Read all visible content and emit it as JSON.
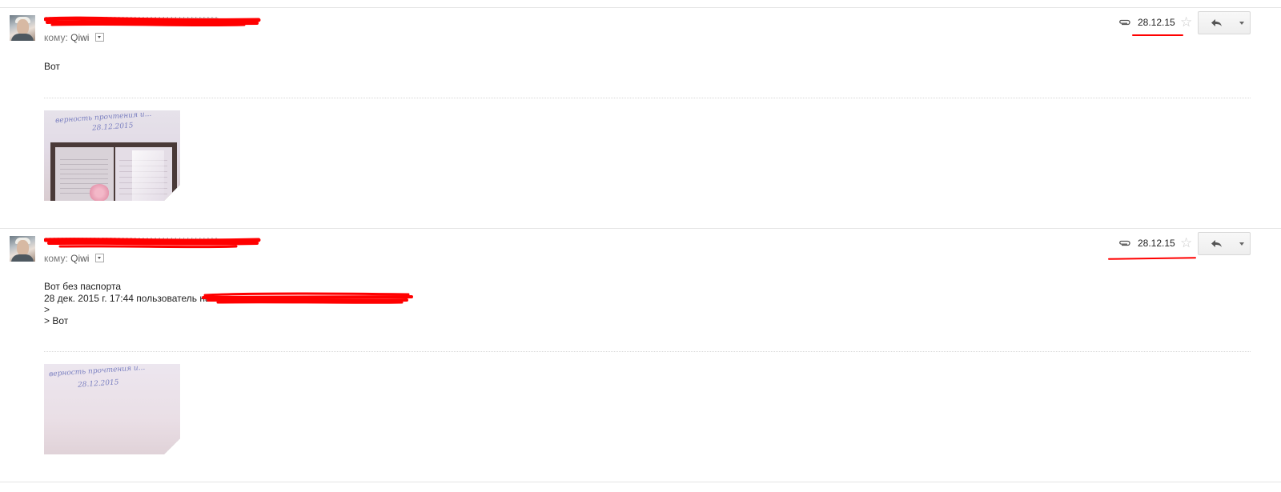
{
  "messages": [
    {
      "sender": "*******************************************",
      "to_label": "кому:",
      "to_name": "Qiwi",
      "date": "28.12.15",
      "body": [
        "Вот"
      ],
      "attachment": {
        "handwriting_line1": "верность прочтения и...",
        "handwriting_line2": "28.12.2015",
        "shows_passport": true
      }
    },
    {
      "sender": "*******************************************",
      "to_label": "кому:",
      "to_name": "Qiwi",
      "date": "28.12.15",
      "body": [
        "Вот без паспорта",
        "28 дек. 2015 г. 17:44 пользователь                                          написал:",
        ">",
        "> Вот"
      ],
      "attachment": {
        "handwriting_line1": "верность прочтения и...",
        "handwriting_line2": "28.12.2015",
        "shows_passport": false
      }
    }
  ],
  "icons": {
    "attachment": "paperclip-icon",
    "star": "star-icon",
    "reply": "reply-arrow-icon",
    "more": "chevron-down-icon"
  },
  "colors": {
    "redaction": "#ff0000",
    "link_muted": "#777777",
    "star": "#c8c8c8"
  },
  "star_glyph": "☆"
}
